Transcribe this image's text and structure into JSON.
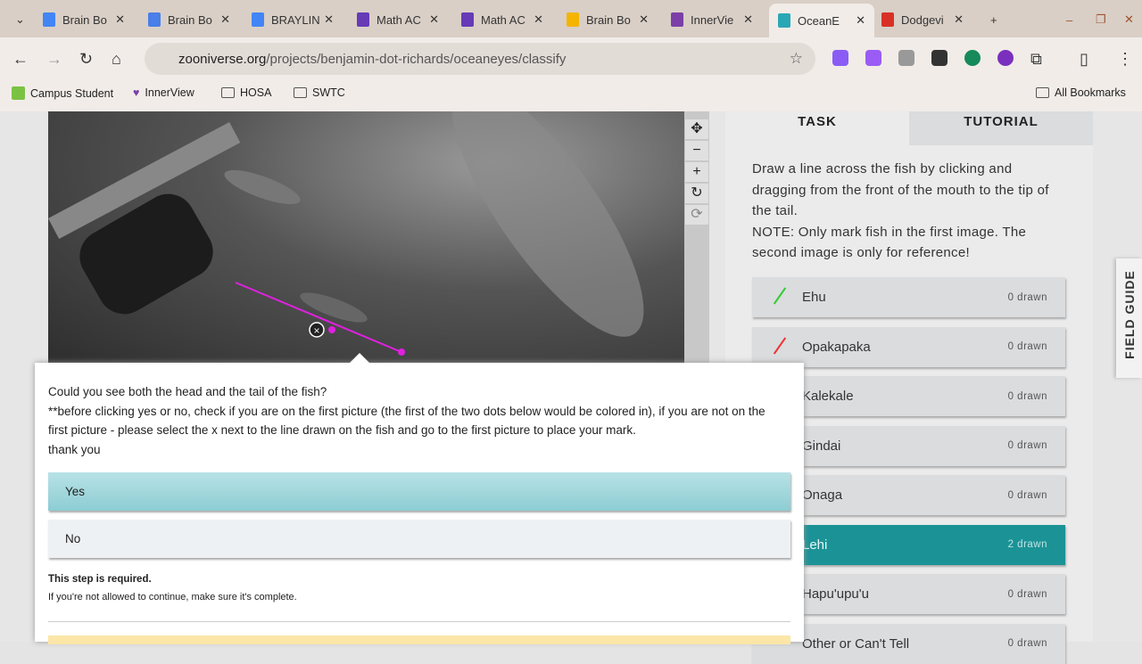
{
  "browser": {
    "tabs": [
      {
        "title": "Brain Bo",
        "color": "#4285f4"
      },
      {
        "title": "Brain Bo",
        "color": "#4a7ee8"
      },
      {
        "title": "BRAYLIN",
        "color": "#4285f4"
      },
      {
        "title": "Math AC",
        "color": "#673ab7"
      },
      {
        "title": "Math AC",
        "color": "#673ab7"
      },
      {
        "title": "Brain Bo",
        "color": "#f4b400"
      },
      {
        "title": "InnerVie",
        "color": "#7b3fa8"
      },
      {
        "title": "OceanE",
        "color": "#2aa7b5"
      },
      {
        "title": "Dodgevi",
        "color": "#d93025"
      }
    ],
    "url_domain": "zooniverse.org",
    "url_path": "/projects/benjamin-dot-richards/oceaneyes/classify",
    "bookmarks": [
      "Campus Student",
      "InnerView",
      "HOSA",
      "SWTC"
    ],
    "all_bookmarks": "All Bookmarks"
  },
  "sidebar": {
    "tabs": [
      "TASK",
      "TUTORIAL"
    ],
    "instruction": "Draw a line across the fish by clicking and dragging from the front of the mouth to the tip of the tail.",
    "note": "NOTE: Only mark fish in the first image. The second image is only for reference!",
    "choices": [
      {
        "name": "Ehu",
        "count": "0 drawn",
        "color": "#33cc33"
      },
      {
        "name": "Opakapaka",
        "count": "0 drawn",
        "color": "#ee3333"
      },
      {
        "name": "Kalekale",
        "count": "0 drawn"
      },
      {
        "name": "Gindai",
        "count": "0 drawn"
      },
      {
        "name": "Onaga",
        "count": "0 drawn"
      },
      {
        "name": "Lehi",
        "count": "2 drawn",
        "selected": true
      },
      {
        "name": "Hapu'upu'u",
        "count": "0 drawn"
      },
      {
        "name": "Other or Can't Tell",
        "count": "0 drawn"
      }
    ],
    "field_guide": "FIELD GUIDE"
  },
  "popup": {
    "question": "Could you see both the head and the tail of the fish?",
    "detail": "**before clicking yes or no, check if you are on the first picture (the first of the two dots below would be colored in), if you are not on the first picture - please select the x next to the line drawn on the fish and go to the first picture to place your mark.",
    "thanks": "thank you",
    "answers": [
      "Yes",
      "No"
    ],
    "required": "This step is required.",
    "hint": "If you're not allowed to continue, make sure it's complete."
  }
}
